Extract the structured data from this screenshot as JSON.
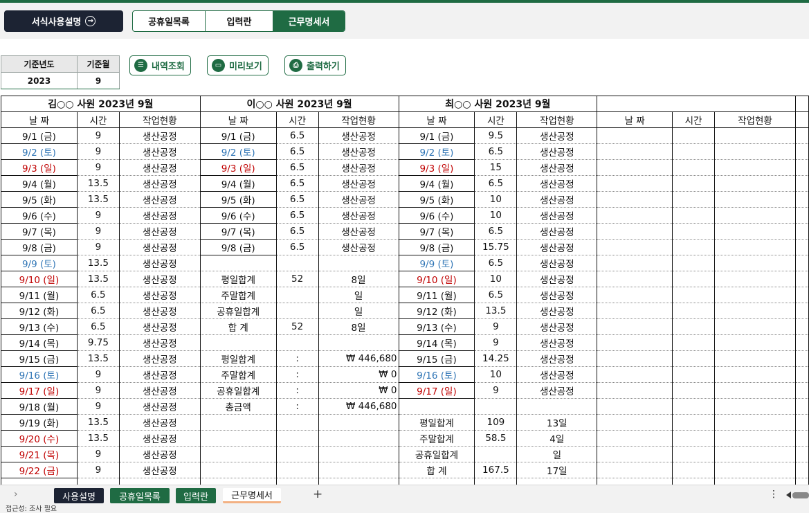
{
  "top": {
    "guide_label": "서식사용설명",
    "guide_icon": "→",
    "tabs": [
      {
        "label": "공휴일목록",
        "active": false
      },
      {
        "label": "입력란",
        "active": false
      },
      {
        "label": "근무명세서",
        "active": true
      }
    ]
  },
  "year_panel": {
    "year_label": "기준년도",
    "month_label": "기준월",
    "year": "2023",
    "month": "9"
  },
  "actions": {
    "history": "내역조회",
    "preview": "미리보기",
    "print": "출력하기"
  },
  "sheet": {
    "headers": {
      "date": "날 짜",
      "hours": "시간",
      "status": "작업현황"
    },
    "summary_labels": {
      "weekday_total": "평일합계",
      "weekend_total": "주말합계",
      "holiday_total": "공휴일합계",
      "total": "합 계",
      "pay_total": "총금액",
      "colon": ":"
    },
    "emp1": {
      "title": "김○○  사원  2023년 9월",
      "rows": [
        {
          "date": "9/1 (금)",
          "hours": "9",
          "status": "생산공정",
          "c": ""
        },
        {
          "date": "9/2 (토)",
          "hours": "9",
          "status": "생산공정",
          "c": "blue"
        },
        {
          "date": "9/3 (일)",
          "hours": "9",
          "status": "생산공정",
          "c": "red"
        },
        {
          "date": "9/4 (월)",
          "hours": "13.5",
          "status": "생산공정",
          "c": ""
        },
        {
          "date": "9/5 (화)",
          "hours": "13.5",
          "status": "생산공정",
          "c": ""
        },
        {
          "date": "9/6 (수)",
          "hours": "9",
          "status": "생산공정",
          "c": ""
        },
        {
          "date": "9/7 (목)",
          "hours": "9",
          "status": "생산공정",
          "c": ""
        },
        {
          "date": "9/8 (금)",
          "hours": "9",
          "status": "생산공정",
          "c": ""
        },
        {
          "date": "9/9 (토)",
          "hours": "13.5",
          "status": "생산공정",
          "c": "blue"
        },
        {
          "date": "9/10 (일)",
          "hours": "13.5",
          "status": "생산공정",
          "c": "red"
        },
        {
          "date": "9/11 (월)",
          "hours": "6.5",
          "status": "생산공정",
          "c": ""
        },
        {
          "date": "9/12 (화)",
          "hours": "6.5",
          "status": "생산공정",
          "c": ""
        },
        {
          "date": "9/13 (수)",
          "hours": "6.5",
          "status": "생산공정",
          "c": ""
        },
        {
          "date": "9/14 (목)",
          "hours": "9.75",
          "status": "생산공정",
          "c": ""
        },
        {
          "date": "9/15 (금)",
          "hours": "13.5",
          "status": "생산공정",
          "c": ""
        },
        {
          "date": "9/16 (토)",
          "hours": "9",
          "status": "생산공정",
          "c": "blue"
        },
        {
          "date": "9/17 (일)",
          "hours": "9",
          "status": "생산공정",
          "c": "red"
        },
        {
          "date": "9/18 (월)",
          "hours": "9",
          "status": "생산공정",
          "c": ""
        },
        {
          "date": "9/19 (화)",
          "hours": "13.5",
          "status": "생산공정",
          "c": ""
        },
        {
          "date": "9/20 (수)",
          "hours": "13.5",
          "status": "생산공정",
          "c": "red"
        },
        {
          "date": "9/21 (목)",
          "hours": "9",
          "status": "생산공정",
          "c": "red"
        },
        {
          "date": "9/22 (금)",
          "hours": "9",
          "status": "생산공정",
          "c": "red"
        }
      ]
    },
    "emp2": {
      "title": "이○○  사원  2023년 9월",
      "rows": [
        {
          "date": "9/1 (금)",
          "hours": "6.5",
          "status": "생산공정",
          "c": ""
        },
        {
          "date": "9/2 (토)",
          "hours": "6.5",
          "status": "생산공정",
          "c": "blue"
        },
        {
          "date": "9/3 (일)",
          "hours": "6.5",
          "status": "생산공정",
          "c": "red"
        },
        {
          "date": "9/4 (월)",
          "hours": "6.5",
          "status": "생산공정",
          "c": ""
        },
        {
          "date": "9/5 (화)",
          "hours": "6.5",
          "status": "생산공정",
          "c": ""
        },
        {
          "date": "9/6 (수)",
          "hours": "6.5",
          "status": "생산공정",
          "c": ""
        },
        {
          "date": "9/7 (목)",
          "hours": "6.5",
          "status": "생산공정",
          "c": ""
        },
        {
          "date": "9/8 (금)",
          "hours": "6.5",
          "status": "생산공정",
          "c": ""
        }
      ],
      "weekday_hours": "52",
      "weekday_days": "8일",
      "weekend_days": "일",
      "holiday_days": "일",
      "total_hours": "52",
      "total_days": "8일",
      "weekday_pay": "₩ 446,680",
      "weekend_pay": "₩ 0",
      "holiday_pay": "₩ 0",
      "total_pay": "₩ 446,680"
    },
    "emp3": {
      "title": "최○○  사원  2023년 9월",
      "rows": [
        {
          "date": "9/1 (금)",
          "hours": "9.5",
          "status": "생산공정",
          "c": ""
        },
        {
          "date": "9/2 (토)",
          "hours": "6.5",
          "status": "생산공정",
          "c": "blue"
        },
        {
          "date": "9/3 (일)",
          "hours": "15",
          "status": "생산공정",
          "c": "red"
        },
        {
          "date": "9/4 (월)",
          "hours": "6.5",
          "status": "생산공정",
          "c": ""
        },
        {
          "date": "9/5 (화)",
          "hours": "10",
          "status": "생산공정",
          "c": ""
        },
        {
          "date": "9/6 (수)",
          "hours": "10",
          "status": "생산공정",
          "c": ""
        },
        {
          "date": "9/7 (목)",
          "hours": "6.5",
          "status": "생산공정",
          "c": ""
        },
        {
          "date": "9/8 (금)",
          "hours": "15.75",
          "status": "생산공정",
          "c": ""
        },
        {
          "date": "9/9 (토)",
          "hours": "6.5",
          "status": "생산공정",
          "c": "blue"
        },
        {
          "date": "9/10 (일)",
          "hours": "10",
          "status": "생산공정",
          "c": "red"
        },
        {
          "date": "9/11 (월)",
          "hours": "6.5",
          "status": "생산공정",
          "c": ""
        },
        {
          "date": "9/12 (화)",
          "hours": "13.5",
          "status": "생산공정",
          "c": ""
        },
        {
          "date": "9/13 (수)",
          "hours": "9",
          "status": "생산공정",
          "c": ""
        },
        {
          "date": "9/14 (목)",
          "hours": "9",
          "status": "생산공정",
          "c": ""
        },
        {
          "date": "9/15 (금)",
          "hours": "14.25",
          "status": "생산공정",
          "c": ""
        },
        {
          "date": "9/16 (토)",
          "hours": "10",
          "status": "생산공정",
          "c": "blue"
        },
        {
          "date": "9/17 (일)",
          "hours": "9",
          "status": "생산공정",
          "c": "red"
        }
      ],
      "weekday_hours": "109",
      "weekday_days": "13일",
      "weekend_hours": "58.5",
      "weekend_days": "4일",
      "holiday_days": "일",
      "total_hours": "167.5",
      "total_days": "17일"
    }
  },
  "sheet_tabs": [
    {
      "label": "사용설명",
      "style": "dark"
    },
    {
      "label": "공휴일목록",
      "style": "green"
    },
    {
      "label": "입력란",
      "style": "green"
    },
    {
      "label": "근무명세서",
      "style": "cur"
    }
  ],
  "sheet_bar": {
    "prev": "›",
    "add": "+",
    "more": "⋮"
  },
  "status_text": "접근성: 조사 필요",
  "colors": {
    "accent": "#1f6b43",
    "dark": "#1c2333",
    "saturday": "#2e74b5",
    "sunday": "#c00000"
  }
}
